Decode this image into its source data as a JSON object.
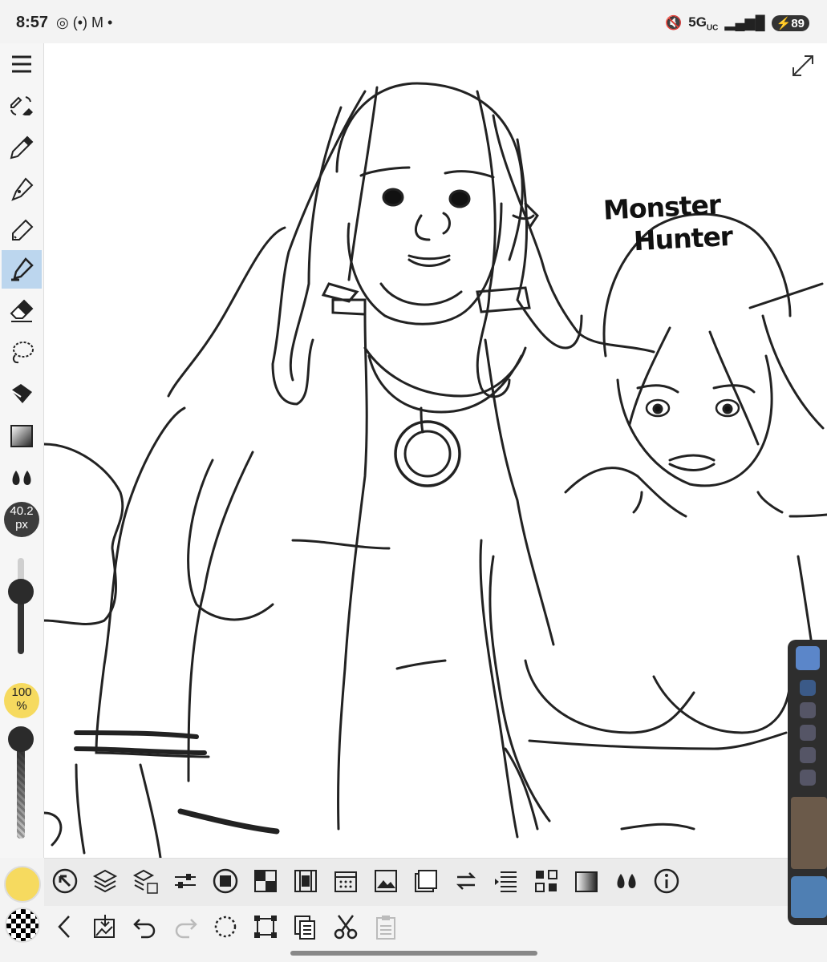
{
  "status": {
    "time": "8:57",
    "network": "5G",
    "network_sub": "UC",
    "battery": "89",
    "left_icons": "◎ (•) M •"
  },
  "tools": {
    "menu": "menu-icon",
    "size": {
      "value": "40.2",
      "unit": "px",
      "level": 0.65
    },
    "opacity": {
      "value": "100",
      "unit": "%",
      "level": 1.0
    }
  },
  "canvas": {
    "text_line1": "Monster",
    "text_line2": "Hunter"
  },
  "colors": {
    "accent": "#bcd6ee",
    "primary_color": "#f6da5f",
    "size_badge": "#3c3c3c"
  },
  "bottom_icons": [
    "adjust-icon",
    "layers-icon",
    "layer-props-icon",
    "sliders-icon",
    "circle-icon",
    "grid-icon",
    "film-icon",
    "calendar-icon",
    "image-icon",
    "frames-icon",
    "swap-icon",
    "list-icon",
    "nodes-icon",
    "gradient-icon",
    "drops-icon",
    "info-icon"
  ],
  "bottom_icons2": [
    "back-icon",
    "save-icon",
    "undo-icon",
    "redo-icon",
    "select-icon",
    "transform-icon",
    "copy-icon",
    "cut-icon",
    "paste-icon"
  ]
}
